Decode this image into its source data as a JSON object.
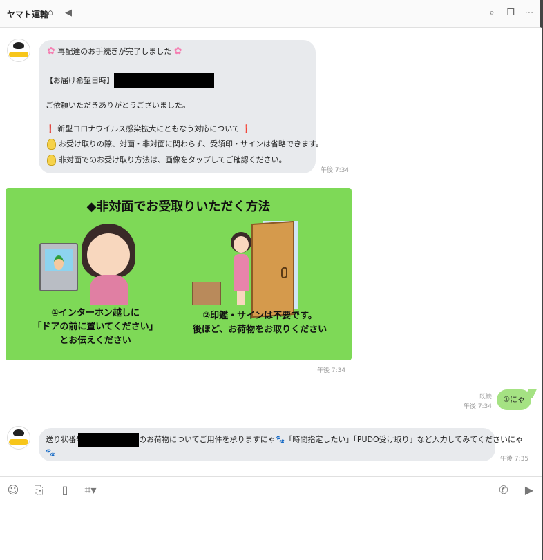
{
  "header": {
    "title": "ヤマト運輸",
    "icons": [
      "home-icon",
      "speaker-mute-icon",
      "search-icon",
      "copy-icon",
      "more-icon"
    ]
  },
  "messages": {
    "first": {
      "line1": "再配達のお手続きが完了しました",
      "line2_prefix": "【お届け希望日時】",
      "line3": "ご依頼いただきありがとうございました。",
      "line4": "新型コロナウイルス感染拡大にともなう対応について",
      "line5": "お受け取りの際、対面・非対面に関わらず、受領印・サインは省略できます。",
      "line6": "非対面でのお受け取り方法は、画像をタップしてご確認ください。",
      "time": "午後 7:34"
    },
    "image": {
      "title": "◆非対面でお受取りいただく方法",
      "caption_left_1": "①インターホン越しに",
      "caption_left_2": "「ドアの前に置いてください」",
      "caption_left_3": "とお伝えください",
      "caption_right_1": "②印鑑・サインは不要です。",
      "caption_right_2": "後ほど、お荷物をお取りください",
      "time": "午後 7:34"
    },
    "mine": {
      "text": "①にゃ",
      "read_label": "既読",
      "time": "午後 7:34"
    },
    "last": {
      "text_prefix": "送り状番号",
      "text_suffix": "のお荷物についてご用件を承りますにゃ",
      "text_suffix2": "「時間指定したい」「PUDO受け取り」など入力してみてくださいにゃ",
      "time": "午後 7:35"
    }
  },
  "toolbar": {
    "icons": [
      "emoji-icon",
      "attach-icon",
      "bookmark-icon",
      "crop-icon",
      "phone-icon",
      "video-icon"
    ]
  },
  "colors": {
    "bubble_incoming": "#e8eaed",
    "bubble_outgoing": "#a5e283",
    "image_bg": "#7ed957"
  }
}
